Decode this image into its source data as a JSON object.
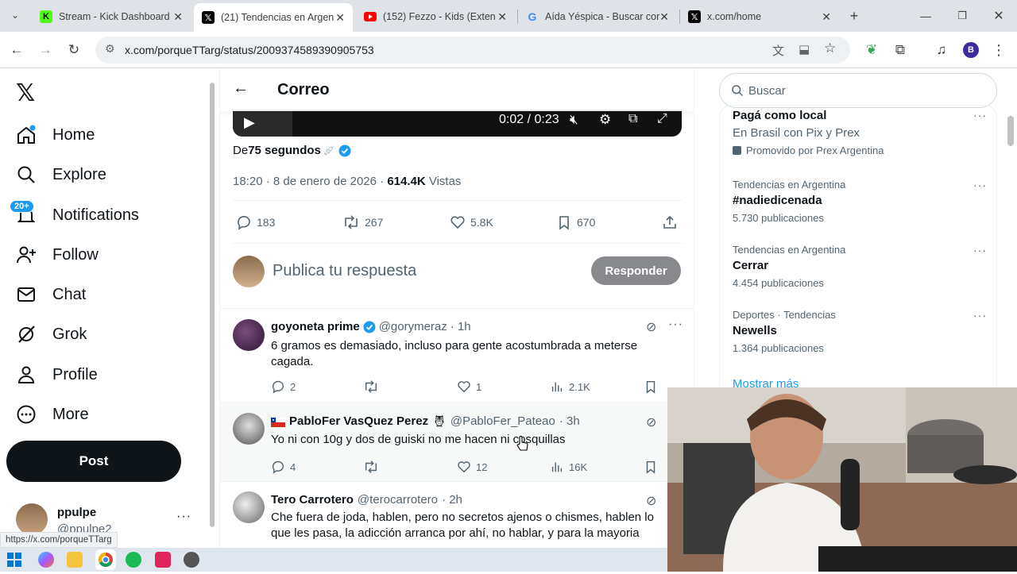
{
  "browser": {
    "tabs": [
      {
        "title": "Stream - Kick Dashboard",
        "icon": "kick-icon"
      },
      {
        "title": "(21) Tendencias en Argen",
        "icon": "x-icon"
      },
      {
        "title": "(152) Fezzo - Kids (Exten",
        "icon": "youtube-icon"
      },
      {
        "title": "Aída Yéspica - Buscar cor",
        "icon": "google-icon"
      },
      {
        "title": "x.com/home",
        "icon": "x-icon"
      }
    ],
    "url": "x.com/porqueTTarg/status/2009374589390905753",
    "profile_initial": "B",
    "status_url": "https://x.com/porqueTTarg"
  },
  "nav": {
    "items": [
      {
        "label": "Home",
        "icon": "home-icon"
      },
      {
        "label": "Explore",
        "icon": "search-icon"
      },
      {
        "label": "Notifications",
        "icon": "bell-icon",
        "badge": "20+"
      },
      {
        "label": "Follow",
        "icon": "follow-icon"
      },
      {
        "label": "Chat",
        "icon": "mail-icon"
      },
      {
        "label": "Grok",
        "icon": "grok-icon"
      },
      {
        "label": "Profile",
        "icon": "profile-icon"
      },
      {
        "label": "More",
        "icon": "more-icon"
      }
    ],
    "post_label": "Post",
    "account": {
      "name": "ppulpe",
      "handle": "@ppulpe2"
    }
  },
  "main": {
    "header_title": "Correo",
    "video": {
      "time": "0:02 / 0:23"
    },
    "from_prefix": "De",
    "from_name": "75 segundos",
    "timestamp": "18:20 · 8 de enero de 2026 · ",
    "views_count": "614.4K",
    "views_label": "Vistas",
    "stats": {
      "replies": "183",
      "reposts": "267",
      "likes": "5.8K",
      "bookmarks": "670"
    },
    "compose_placeholder": "Publica tu respuesta",
    "reply_button": "Responder",
    "replies": [
      {
        "name": "goyoneta prime",
        "handle": "@gorymeraz",
        "time": "· 1h",
        "text": "6 gramos es demasiado, incluso para gente acostumbrada a meterse cagada.",
        "replies": "2",
        "likes": "1",
        "views": "2.1K"
      },
      {
        "name": "PabloFer VasQuez Perez",
        "handle": "@PabloFer_Pateao",
        "time": "· 3h",
        "text": "Yo ni con 10g y dos de guiski no me hacen ni cosquillas",
        "replies": "4",
        "likes": "12",
        "views": "16K"
      },
      {
        "name": "Tero Carrotero",
        "handle": "@terocarrotero",
        "time": "· 2h",
        "text_line1": "Che fuera de joda, hablen, pero no secretos ajenos o chismes, hablen lo",
        "text_line2": "que les pasa, la adicción arranca por ahí, no hablar, y para la mayoria"
      }
    ]
  },
  "sidebar": {
    "search_placeholder": "Buscar",
    "trends": [
      {
        "meta": "",
        "name": "Pagá como local",
        "detail": "En Brasil con Pix y Prex",
        "promoted": "Promovido por Prex Argentina"
      },
      {
        "meta": "Tendencias en Argentina",
        "name": "#nadiedicenada",
        "count": "5.730 publicaciones"
      },
      {
        "meta": "Tendencias en Argentina",
        "name": "Cerrar",
        "count": "4.454 publicaciones"
      },
      {
        "meta": "Deportes · Tendencias",
        "name": "Newells",
        "count": "1.364 publicaciones"
      }
    ],
    "show_more": "Mostrar más"
  },
  "colors": {
    "accent": "#1d9bf0",
    "dark": "#0f1419",
    "muted": "#536471",
    "reply_btn": "#87898c"
  }
}
